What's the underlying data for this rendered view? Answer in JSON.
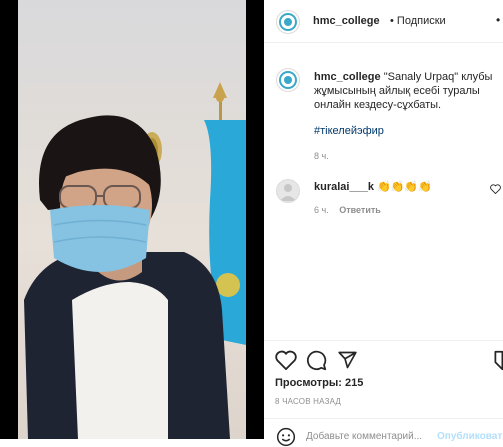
{
  "post": {
    "author": "hmc_college",
    "follow_label": "• Подписки",
    "more_label": "•",
    "caption": "\"Sanaly Urpaq\" клубы жұмысының айлық есебі туралы онлайн кездесу-сұхбаты.",
    "hashtag": "#тікелейэфир",
    "caption_time": "8 ч.",
    "views_label": "Просмотры: 215",
    "time_ago": "8 ЧАСОВ НАЗАД"
  },
  "comments": [
    {
      "username": "kuralai___k",
      "emoji": "👏👏👏👏",
      "time": "6 ч.",
      "reply_label": "Ответить"
    }
  ],
  "comment_box": {
    "placeholder": "Добавьте комментарий...",
    "submit_label": "Опубликовать"
  },
  "icons": {
    "like": "heart-icon",
    "comment": "comment-icon",
    "share": "share-icon",
    "save": "bookmark-icon",
    "emoji": "smiley-icon"
  },
  "colors": {
    "link": "#00376b",
    "muted": "#8e8e8e",
    "submit": "#b2dffc",
    "flag": "#2aa8d8"
  }
}
